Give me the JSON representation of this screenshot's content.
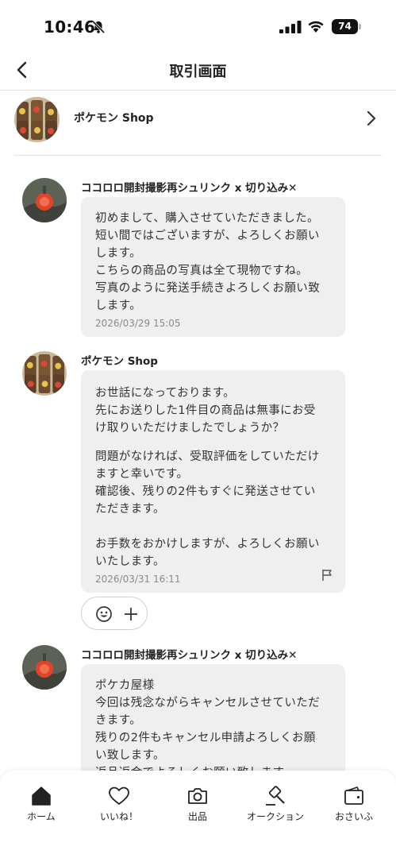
{
  "status_bar": {
    "time": "10:46",
    "battery": "74"
  },
  "nav": {
    "title": "取引画面"
  },
  "shop": {
    "name": "ポケモン Shop"
  },
  "messages": [
    {
      "sender": "ココロロ開封撮影再シュリンク x 切り込み✕",
      "lines": [
        "初めまして、購入させていただきました。",
        "短い間ではございますが、よろしくお願い",
        "します。",
        "こちらの商品の写真は全て現物ですね。",
        "写真のように発送手続きよろしくお願い致",
        "します。"
      ],
      "time": "2026/03/29 15:05"
    },
    {
      "sender": "ポケモン Shop",
      "lines": [
        "お世話になっております。",
        "先にお送りした1件目の商品は無事にお受",
        "け取りいただけましたでしょうか？",
        "",
        "問題がなければ、受取評価をしていただけ",
        "ますと幸いです。",
        "確認後、残りの2件もすぐに発送させてい",
        "ただきます。",
        "",
        "お手数をおかけしますが、よろしくお願い",
        "いたします。"
      ],
      "time": "2026/03/31 16:11"
    },
    {
      "sender": "ココロロ開封撮影再シュリンク x 切り込み✕",
      "lines": [
        "ポケカ屋様",
        "今回は残念ながらキャンセルさせていただ",
        "きます。",
        "残りの2件もキャンセル申請よろしくお願",
        "い致します。",
        "返品返金でよろしくお願い致します。"
      ]
    }
  ],
  "tabs": [
    {
      "label": "ホーム",
      "icon": "home-icon"
    },
    {
      "label": "いいね！",
      "icon": "heart-icon"
    },
    {
      "label": "出品",
      "icon": "camera-icon"
    },
    {
      "label": "オークション",
      "icon": "gavel-icon"
    },
    {
      "label": "おさいふ",
      "icon": "wallet-icon"
    }
  ],
  "colors": {
    "bubble": "#efefef",
    "timestamp": "#8a8a8a",
    "avatar_red": "#e0452c"
  }
}
